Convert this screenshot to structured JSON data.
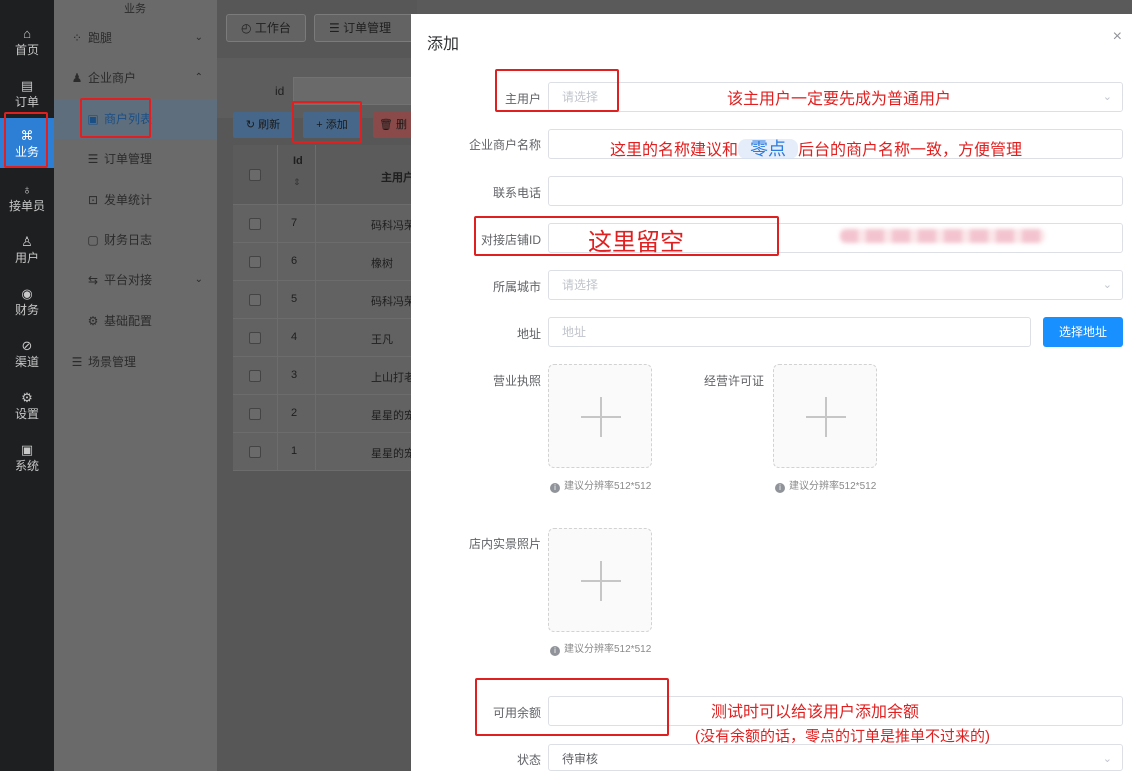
{
  "rail": [
    {
      "label": "首页",
      "icon": "home-icon",
      "glyph": "⌂"
    },
    {
      "label": "订单",
      "icon": "order-icon",
      "glyph": "▤"
    },
    {
      "label": "业务",
      "icon": "business-icon",
      "glyph": "⌘"
    },
    {
      "label": "接单员",
      "icon": "bike-icon",
      "glyph": "♁"
    },
    {
      "label": "用户",
      "icon": "user-icon",
      "glyph": "♙"
    },
    {
      "label": "财务",
      "icon": "finance-icon",
      "glyph": "◉"
    },
    {
      "label": "渠道",
      "icon": "channel-icon",
      "glyph": "⊘"
    },
    {
      "label": "设置",
      "icon": "settings-icon",
      "glyph": "⚙"
    },
    {
      "label": "系统",
      "icon": "system-icon",
      "glyph": "▣"
    }
  ],
  "submenu": {
    "title": "业务",
    "items": [
      {
        "label": "跑腿",
        "glyph": "⁘",
        "arrow": "⌄"
      },
      {
        "label": "企业商户",
        "glyph": "♟",
        "arrow": "⌃"
      },
      {
        "label": "商户列表",
        "glyph": "▣"
      },
      {
        "label": "订单管理",
        "glyph": "☰"
      },
      {
        "label": "发单统计",
        "glyph": "⊡"
      },
      {
        "label": "财务日志",
        "glyph": "▢"
      },
      {
        "label": "平台对接",
        "glyph": "⇆",
        "arrow": "⌄"
      },
      {
        "label": "基础配置",
        "glyph": "⚙"
      },
      {
        "label": "场景管理",
        "glyph": "☰"
      }
    ]
  },
  "tabs": [
    {
      "label": "工作台",
      "glyph": "◴"
    },
    {
      "label": "订单管理",
      "glyph": "☰"
    }
  ],
  "search": {
    "id_label": "id"
  },
  "toolbar": {
    "refresh_label": "刷新",
    "refresh_glyph": "↻",
    "add_label": "添加",
    "add_glyph": "+",
    "delete_label": "删",
    "delete_glyph": "🗑"
  },
  "table": {
    "headers": [
      "Id",
      "主用户"
    ],
    "rows": [
      {
        "id": "7",
        "name": "码科冯荣"
      },
      {
        "id": "6",
        "name": "橡树"
      },
      {
        "id": "5",
        "name": "码科冯荣"
      },
      {
        "id": "4",
        "name": "王凡"
      },
      {
        "id": "3",
        "name": "上山打老"
      },
      {
        "id": "2",
        "name": "星星的宠"
      },
      {
        "id": "1",
        "name": "星星的宠"
      }
    ]
  },
  "drawer": {
    "title": "添加",
    "close_glyph": "×",
    "fields": {
      "main_user": {
        "label": "主用户",
        "placeholder": "请选择",
        "chevron": "⌄"
      },
      "company_name": {
        "label": "企业商户名称"
      },
      "phone": {
        "label": "联系电话"
      },
      "shop_id": {
        "label": "对接店铺ID"
      },
      "city": {
        "label": "所属城市",
        "placeholder": "请选择",
        "chevron": "⌄"
      },
      "address": {
        "label": "地址",
        "placeholder": "地址",
        "button": "选择地址"
      },
      "license": {
        "label": "营业执照",
        "hint": "建议分辨率512*512"
      },
      "permit": {
        "label": "经营许可证",
        "hint": "建议分辨率512*512"
      },
      "photo": {
        "label": "店内实景照片",
        "hint": "建议分辨率512*512"
      },
      "balance": {
        "label": "可用余额"
      },
      "status": {
        "label": "状态",
        "value": "待审核"
      }
    }
  },
  "annotations": {
    "main_user_note": "该主用户一定要先成为普通用户",
    "name_note_a": "这里的名称建议和",
    "name_note_b": "零点",
    "name_note_c": "后台的商户名称一致，方便管理",
    "shop_id_note": "这里留空",
    "balance_note_1": "测试时可以给该用户添加余额",
    "balance_note_2": "(没有余额的话，零点的订单是推单不过来的)"
  },
  "colors": {
    "primary": "#1890ff",
    "annotation": "#e02020",
    "rail_active": "#2d7fd6"
  }
}
